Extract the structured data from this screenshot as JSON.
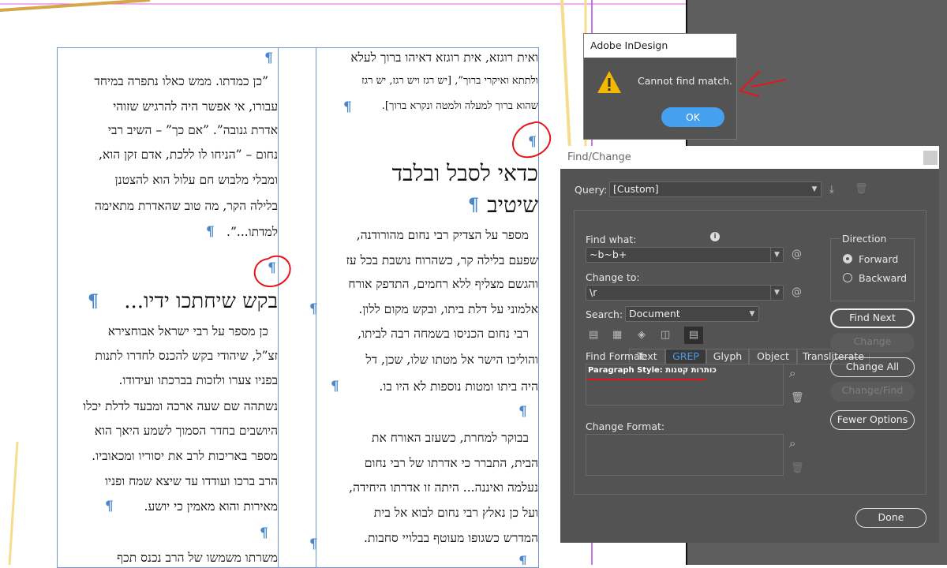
{
  "document": {
    "left_column": {
      "lines_a": [
        "”כן כמדתו. ממש כאלו נתפרה במיחד",
        "עבורו, אי אפשר היה להרגיש שזוהי",
        "אדרת גנובה”. ”אם כך” – השיב רבי",
        "נחום – ”הניחו לו ללכת, אדם זקן הוא,",
        "ומבלי מלבוש חם עלול הוא להצטנן",
        "בלילה הקר, מה טוב שהאדרת מתאימה",
        "למדתו...”."
      ],
      "heading": "בקש שיחתכו ידיו...",
      "lines_b": [
        "כן מספר על רבי ישראל אבוחצירא",
        "זצ”ל, שיהודי בקש להכנס לחדרו לתנות",
        "בפניו צערו ולזכות בברכתו ועידודו.",
        "נשתהה שם שעה ארכה ומבעד לדלת יכלו",
        "היושבים בחדר הסמוך לשמע היאך הוא",
        "מספר באריכות לרב את יסוריו ומכאוביו.",
        "הרב ברכו ועודדו עד שיצא שמח ופניו",
        "מאירות והוא מאמין כי יושע."
      ],
      "lines_c": [
        "משרתו משמשו של הרב נכנס תכף"
      ]
    },
    "right_column": {
      "lines_a": [
        "ואית רוגזא, אית רוגזא דאיהו ברוך לעלא",
        "ולתתא ואיקרי ברוך”, [יש רגז ויש רגז, יש רגז",
        "שהוא ברוך למעלה ולמטה ונקרא ברוך]."
      ],
      "heading": [
        "כדאי לסבל ובלבד",
        "שיטיב"
      ],
      "lines_b": [
        "מספר על הצדיק רבי נחום מהורודנה,",
        "שפעם בלילה קר, כשהרוח נושבת בכל עז",
        "והגשם מצליף ללא רחמים, התדפק אורח",
        "אלמוני על דלת ביתו, ובקש מקום ללון.",
        "רבי נחום הכניסו בשמחה רבה לביתו,",
        "והוליכו הישר אל מטתו שלו, שכן, דל",
        "היה ביתו ומטות נוספות לא היו בו."
      ],
      "lines_c": [
        "בבוקר למחרת, כשעזב האורח את",
        "הבית, התברר כי אדרתו של רבי נחום",
        "נעלמה ואיננה... היתה זו אדרתו היחידה,",
        "ועל כן נאלץ רבי נחום לבוא אל בית",
        "המדרש כשגופו מעוטף בבלויי סחבות."
      ]
    },
    "pilcrow": "¶"
  },
  "alert": {
    "title": "Adobe InDesign",
    "message": "Cannot find match.",
    "ok_label": "OK",
    "icon": "warning-icon"
  },
  "find_change": {
    "title": "Find/Change",
    "query_label": "Query:",
    "query_value": "[Custom]",
    "tabs": [
      "Text",
      "GREP",
      "Glyph",
      "Object",
      "Transliterate"
    ],
    "active_tab": "GREP",
    "find_what_label": "Find what:",
    "find_what_value": "~b~b+",
    "change_to_label": "Change to:",
    "change_to_value": "\\r",
    "search_label": "Search:",
    "search_value": "Document",
    "find_format_label": "Find Format:",
    "find_format_value": "Paragraph Style: כותרות קטנות",
    "change_format_label": "Change Format:",
    "direction_label": "Direction",
    "forward_label": "Forward",
    "backward_label": "Backward",
    "direction_selected": "Forward",
    "buttons": {
      "find_next": "Find Next",
      "change": "Change",
      "change_all": "Change All",
      "change_find": "Change/Find",
      "fewer_options": "Fewer Options",
      "done": "Done"
    },
    "special_char_symbol": "@"
  },
  "colors": {
    "accent": "#4a9cf0",
    "dialog_bg": "#535353",
    "pilcrow": "#4a86c8",
    "annotation": "#e8141c",
    "warning": "#f5b800"
  }
}
